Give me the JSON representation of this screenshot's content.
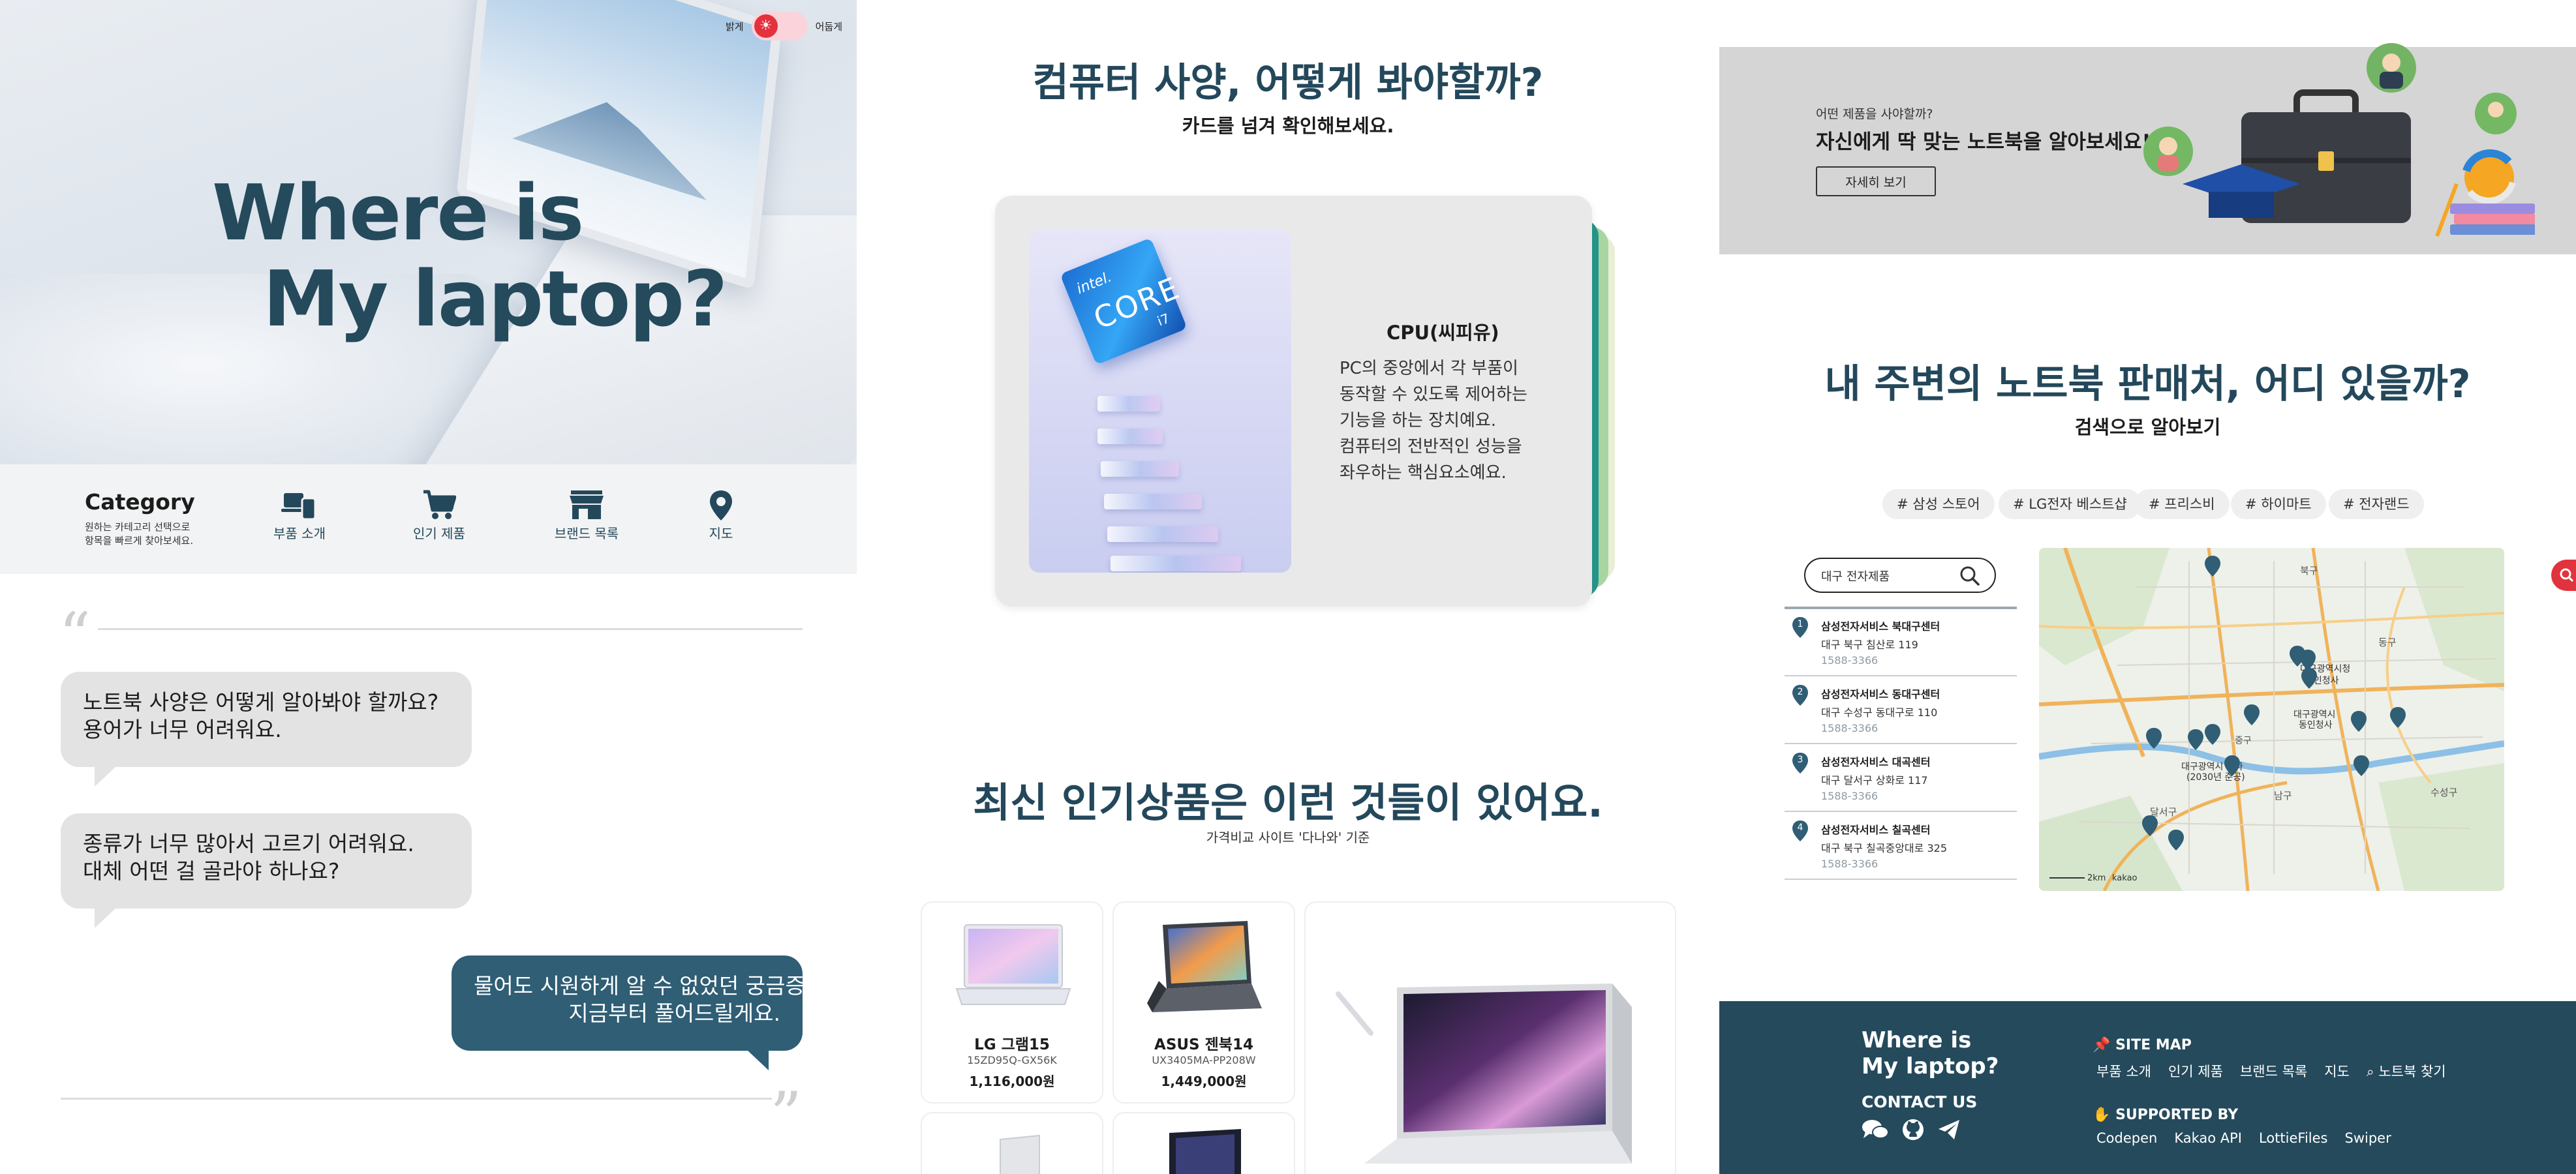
{
  "hero": {
    "title_line1": "Where is",
    "title_line2": "My laptop?",
    "toggle_left": "밝게",
    "toggle_right": "어둡게",
    "toggle_icon": "sun-icon"
  },
  "category": {
    "title": "Category",
    "desc_line1": "원하는 카테고리 선택으로",
    "desc_line2": "항목을 빠르게 찾아보세요.",
    "items": [
      {
        "label": "부품 소개",
        "icon": "parts-icon"
      },
      {
        "label": "인기 제품",
        "icon": "cart-icon"
      },
      {
        "label": "브랜드 목록",
        "icon": "store-icon"
      },
      {
        "label": "지도",
        "icon": "map-pin-icon"
      }
    ]
  },
  "chat": {
    "bubble1_line1": "노트북 사양은 어떻게 알아봐야 할까요?",
    "bubble1_line2": "용어가 너무 어려워요.",
    "bubble2_line1": "종류가 너무 많아서 고르기 어려워요.",
    "bubble2_line2": "대체 어떤 걸 골라야 하나요?",
    "bubble3_line1": "물어도 시원하게 알 수 없었던 궁금증",
    "bubble3_line2": "지금부터 풀어드릴게요."
  },
  "spec": {
    "title": "컴퓨터 사양, 어떻게 봐야할까?",
    "subtitle": "카드를 넘겨 확인해보세요.",
    "card_title": "CPU(씨피유)",
    "card_body": [
      "PC의 중앙에서 각 부품이",
      "동작할 수 있도록 제어하는",
      "기능을 하는 장치예요.",
      "컴퓨터의 전반적인 성능을",
      "좌우하는 핵심요소예요."
    ],
    "chip_brand": "intel.",
    "chip_core": "CORE",
    "chip_tier": "i7"
  },
  "popular": {
    "title": "최신 인기상품은 이런 것들이 있어요.",
    "subtitle": "가격비교 사이트 '다나와' 기준",
    "products": [
      {
        "name": "LG 그램15",
        "model": "15ZD95Q-GX56K",
        "price": "1,116,000원"
      },
      {
        "name": "ASUS 젠북14",
        "model": "UX3405MA-PP208W",
        "price": "1,449,000원"
      }
    ]
  },
  "banner": {
    "small": "어떤 제품을 사야할까?",
    "title": "자신에게 딱 맞는 노트북을 알아보세요!",
    "button": "자세히 보기"
  },
  "stores": {
    "title": "내 주변의 노트북 판매처, 어디 있을까?",
    "subtitle": "검색으로 알아보기",
    "tags": [
      "# 삼성 스토어",
      "# LG전자 베스트샵",
      "# 프리스비",
      "# 하이마트",
      "# 전자랜드"
    ],
    "search_value": "대구 전자제품",
    "list": [
      {
        "num": "1",
        "name": "삼성전자서비스 북대구센터",
        "addr": "대구 북구 침산로 119",
        "tel": "1588-3366"
      },
      {
        "num": "2",
        "name": "삼성전자서비스 동대구센터",
        "addr": "대구 수성구 동대구로 110",
        "tel": "1588-3366"
      },
      {
        "num": "3",
        "name": "삼성전자서비스 대곡센터",
        "addr": "대구 달서구 상화로 117",
        "tel": "1588-3366"
      },
      {
        "num": "4",
        "name": "삼성전자서비스 칠곡센터",
        "addr": "대구 북구 칠곡중앙대로 325",
        "tel": "1588-3366"
      }
    ],
    "map_labels": [
      "북구",
      "대구광역시청",
      "동인청사",
      "대구광역시",
      "동인청사",
      "대구광역시 청사",
      "(2030년 준공)",
      "달서구",
      "수성구",
      "남구",
      "중구",
      "동구"
    ],
    "map_scale": "2km",
    "map_logo": "kakao"
  },
  "footer": {
    "brand_line1": "Where is",
    "brand_line2": "My laptop?",
    "contact": "CONTACT US",
    "sitemap_head": "SITE MAP",
    "sitemap_links": [
      "부품 소개",
      "인기 제품",
      "브랜드 목록",
      "지도",
      "노트북 찾기"
    ],
    "supported_head": "SUPPORTED BY",
    "supported_links": [
      "Codepen",
      "Kakao API",
      "LottieFiles",
      "Swiper"
    ]
  },
  "colors": {
    "primary": "#244a5c",
    "bubble_gray": "#e3e3e3",
    "bubble_blue": "#2f5e75",
    "accent_red": "#e0333d",
    "card_teal": "#2a9d8f"
  }
}
